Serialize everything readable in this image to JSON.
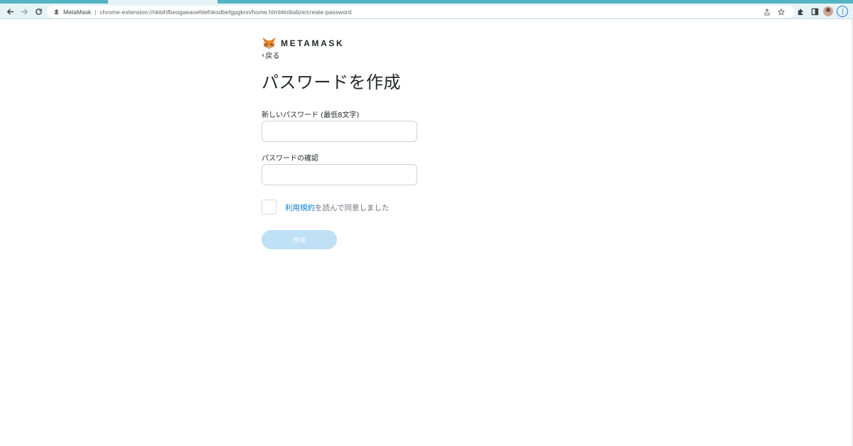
{
  "browser": {
    "tab_site": "MetaMask",
    "separator": "|",
    "url": "chrome-extension://nkbihfbeogaeaoehlefnkodbefgpgknn/home.html#initialize/create-password",
    "colors": {
      "frame": "#54b4c4",
      "toolbar": "#e6f3f6",
      "accent": "#1a73e8"
    }
  },
  "page": {
    "brand": {
      "wordmark": "METAMASK",
      "logo_icon": "fox-icon"
    },
    "back_label": "戻る",
    "title": "パスワードを作成",
    "new_password": {
      "label": "新しいパスワード (最低8文字)",
      "value": "",
      "placeholder": ""
    },
    "confirm_password": {
      "label": "パスワードの確認",
      "value": "",
      "placeholder": ""
    },
    "terms": {
      "link_text": "利用規約",
      "rest_text": "を読んで同意しました",
      "checked": false
    },
    "create_button": "作成",
    "colors": {
      "link": "#037dd6",
      "button_disabled": "#bfe0f5",
      "text": "#24272a"
    }
  }
}
